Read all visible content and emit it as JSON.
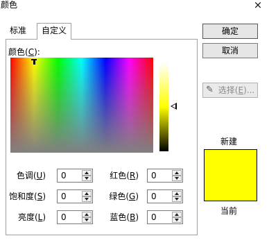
{
  "dialog": {
    "title": "颜色",
    "close": "×"
  },
  "tabs": [
    {
      "label": "标准",
      "active": false
    },
    {
      "label": "自定义",
      "active": true
    }
  ],
  "custom": {
    "colors_label_pre": "颜色(",
    "colors_label_key": "C",
    "colors_label_post": "):"
  },
  "fields": {
    "hue": {
      "pre": "色调(",
      "key": "U",
      "post": ")",
      "value": "0"
    },
    "sat": {
      "pre": "饱和度(",
      "key": "S",
      "post": ")",
      "value": "0"
    },
    "lum": {
      "pre": "亮度(",
      "key": "L",
      "post": ")",
      "value": "0"
    },
    "red": {
      "pre": "红色(",
      "key": "R",
      "post": ")",
      "value": "0"
    },
    "green": {
      "pre": "绿色(",
      "key": "G",
      "post": ")",
      "value": "0"
    },
    "blue": {
      "pre": "蓝色(",
      "key": "B",
      "post": ")",
      "value": "0"
    }
  },
  "buttons": {
    "ok": "确定",
    "cancel": "取消",
    "pick_pre": "选择(",
    "pick_key": "E",
    "pick_post": ")..."
  },
  "preview": {
    "new_label": "新建",
    "current_label": "当前",
    "new_color": "#ffff00",
    "current_color": "#ffff00"
  },
  "luminance": {
    "level": 0.5
  }
}
